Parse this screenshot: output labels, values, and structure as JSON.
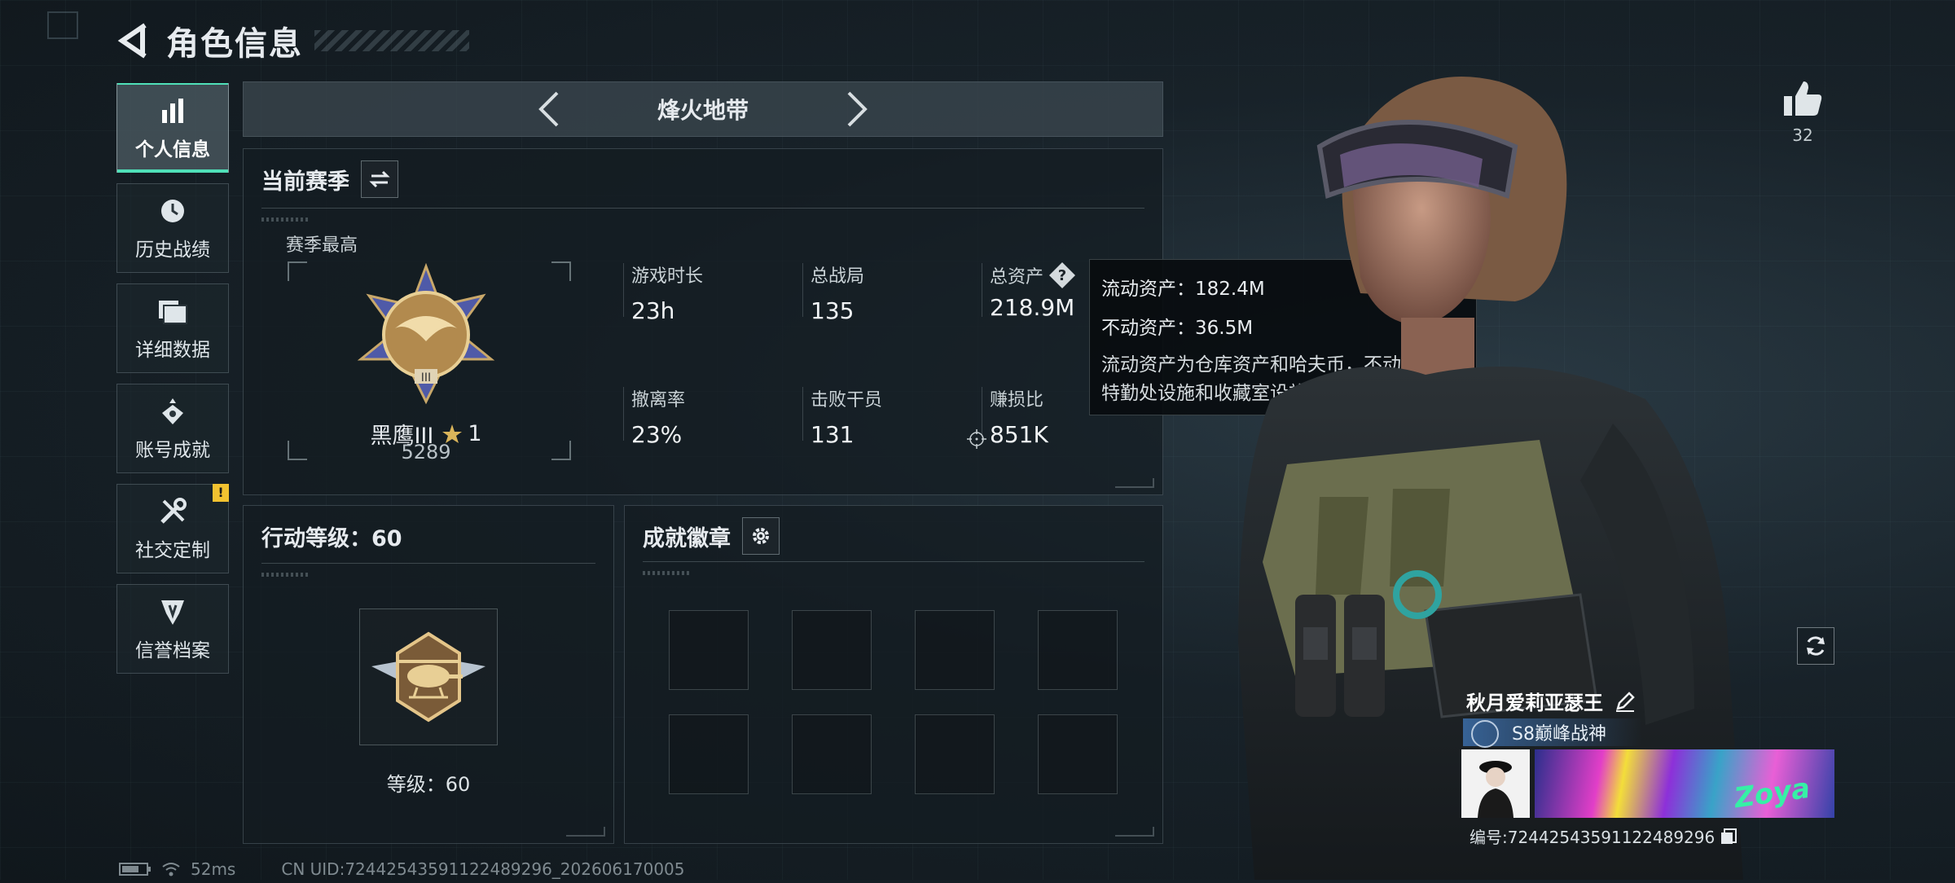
{
  "header": {
    "title": "角色信息"
  },
  "sidebar": {
    "items": [
      {
        "label": "个人信息",
        "icon": "bar-chart-icon",
        "active": true
      },
      {
        "label": "历史战绩",
        "icon": "history-clock-icon"
      },
      {
        "label": "详细数据",
        "icon": "folder-icon"
      },
      {
        "label": "账号成就",
        "icon": "achievement-icon"
      },
      {
        "label": "社交定制",
        "icon": "tools-icon",
        "badge": "!"
      },
      {
        "label": "信誉档案",
        "icon": "credit-emblem-icon"
      }
    ]
  },
  "mode": {
    "title": "烽火地带"
  },
  "season": {
    "title": "当前赛季",
    "best_label": "赛季最高",
    "rank_name": "黑鹰III",
    "rank_stars": "1",
    "rank_points": "5289",
    "stats": [
      {
        "label": "游戏时长",
        "value": "23h"
      },
      {
        "label": "总战局",
        "value": "135"
      },
      {
        "label": "总资产",
        "value": "218.9M"
      },
      {
        "label": "撤离率",
        "value": "23%"
      },
      {
        "label": "击败干员",
        "value": "131"
      },
      {
        "label": "赚损比",
        "value": "851K"
      }
    ]
  },
  "tooltip": {
    "liquid": "流动资产：182.4M",
    "fixed": "不动资产：36.5M",
    "desc": "流动资产为仓库资产和哈夫币，不动资产为特勤处设施和收藏室设施"
  },
  "action_level": {
    "title": "行动等级：60",
    "level_text": "等级：60"
  },
  "badges": {
    "title": "成就徽章",
    "slots": 8
  },
  "profile": {
    "likes": "32",
    "name": "秋月爱莉亚瑟王",
    "title": "S8巅峰战神",
    "banner_text": "Zoya",
    "id_text": "编号:7244254359112248929​6"
  },
  "status": {
    "ping": "52ms",
    "uid": "CN UID:7244254359112248929​6_202606170005"
  },
  "colors": {
    "accent": "#4fe0b8",
    "warning": "#f2c230",
    "title_blue": "#3c6eaa"
  }
}
